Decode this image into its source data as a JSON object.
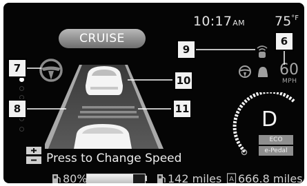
{
  "status_bar": {
    "time": "10:17",
    "am_pm": "AM",
    "temperature": "75",
    "temp_unit": "°F"
  },
  "cruise_label": "CRUISE",
  "callouts": {
    "c6": "6",
    "c7": "7",
    "c8": "8",
    "c9": "9",
    "c10": "10",
    "c11": "11"
  },
  "speed": {
    "value": "60",
    "unit": "MPH"
  },
  "gear": "D",
  "modes": [
    "ECO",
    "e-Pedal"
  ],
  "message": "Press to Change Speed",
  "bottom_bar": {
    "battery_pct": "80%",
    "battery_level": 0.8,
    "range": "142 miles",
    "odometer": "666.8 miles"
  },
  "icons": {
    "steering": "steering-wheel-icon",
    "lane": "lane-icon",
    "radar": "intelligent-cruise-icon",
    "speed_adjust": "plus-minus-switch-icon",
    "fuel": "fuel-pump-icon",
    "odometer": "odometer-a-icon"
  },
  "colors": {
    "background": "#050505",
    "text": "#e2e2e2",
    "callout_bg": "#f2f2f2",
    "gauge": "#ffffff"
  }
}
